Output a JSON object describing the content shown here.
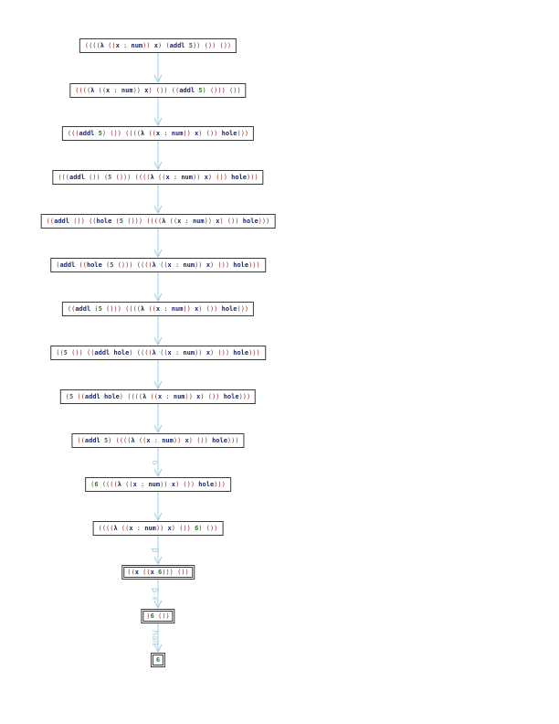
{
  "nodes": [
    {
      "text": "((((λ ((x : num)) x) (addl 5)) ()) ())"
    },
    {
      "text": "((((λ ((x : num)) x) ()) ((addl 5) ())) ())"
    },
    {
      "text": "(((addl 5) ()) ((((λ ((x : num)) x) ()) hole)))"
    },
    {
      "text": "(((addl ()) (5 ())) ((((λ ((x : num)) x) ()) hole)))"
    },
    {
      "text": "((addl ()) ((hole (5 ())) ((((λ ((x : num)) x) ()) hole)))"
    },
    {
      "text": "(addl ((hole (5 ())) ((((λ ((x : num)) x) ()) hole)))"
    },
    {
      "text": "((addl (5 ())) ((((λ ((x : num)) x) ()) hole)))"
    },
    {
      "text": "((5 ()) ((addl hole) ((((λ ((x : num)) x) ()) hole)))"
    },
    {
      "text": "(5 ((addl hole) ((((λ ((x : num)) x) ()) hole)))"
    },
    {
      "text": "((addl 5) ((((λ ((x : num)) x) ()) hole)))"
    },
    {
      "text": "(6 ((((λ ((x : num)) x) ()) hole)))"
    },
    {
      "text": "((((λ ((x : num)) x) ()) 6) ())"
    },
    {
      "text": "((x ((x 6))) ())"
    },
    {
      "text": "(6 ())"
    },
    {
      "text": "6"
    }
  ],
  "edges": [
    {
      "label": ""
    },
    {
      "label": ""
    },
    {
      "label": ""
    },
    {
      "label": ""
    },
    {
      "label": ""
    },
    {
      "label": ""
    },
    {
      "label": ""
    },
    {
      "label": ""
    },
    {
      "label": ""
    },
    {
      "label": "δ"
    },
    {
      "label": ""
    },
    {
      "label": "β"
    },
    {
      "label": "β-x"
    },
    {
      "label": "halt"
    }
  ],
  "colors": {
    "edge": "#9ed0e8",
    "box_border": "#3a3a3a",
    "paren": "#8a2a2a",
    "name": "#1d2a6b",
    "number": "#2a7a2a"
  }
}
